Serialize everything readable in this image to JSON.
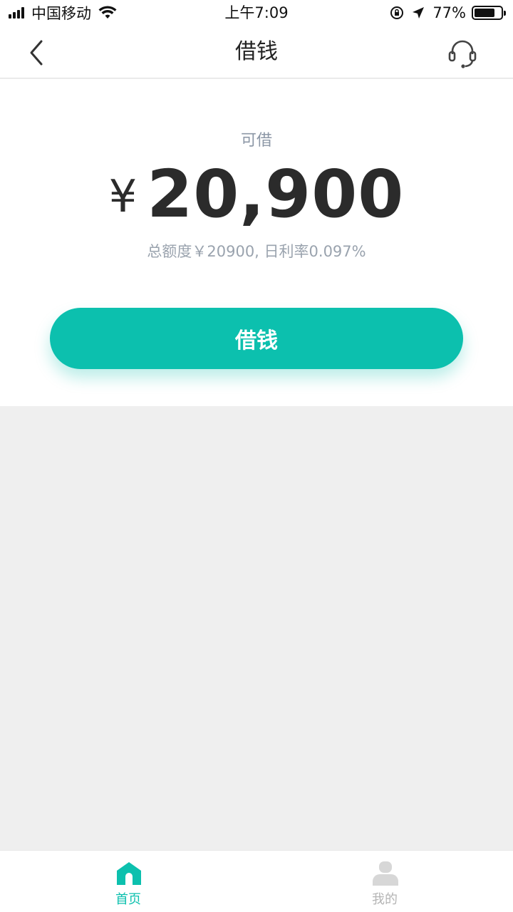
{
  "status_bar": {
    "carrier": "中国移动",
    "time": "上午7:09",
    "battery_percent": "77%",
    "battery_level": 0.77,
    "icons": [
      "signal-icon",
      "wifi-icon",
      "orientation-lock-icon",
      "location-arrow-icon",
      "battery-icon"
    ]
  },
  "nav": {
    "title": "借钱",
    "back_icon": "chevron-left-icon",
    "service_icon": "headset-icon"
  },
  "main": {
    "available_label": "可借",
    "currency_symbol": "¥",
    "amount": "20,900",
    "total_line": "总额度￥20900, 日利率0.097%",
    "borrow_button_label": "借钱"
  },
  "tab_bar": {
    "tabs": [
      {
        "label": "首页",
        "icon": "home-icon",
        "active": true
      },
      {
        "label": "我的",
        "icon": "user-icon",
        "active": false
      }
    ]
  },
  "colors": {
    "accent": "#0cc0ae",
    "background": "#efefef",
    "muted_text": "#9aa3ae",
    "amount_text": "#2b2b2b"
  }
}
